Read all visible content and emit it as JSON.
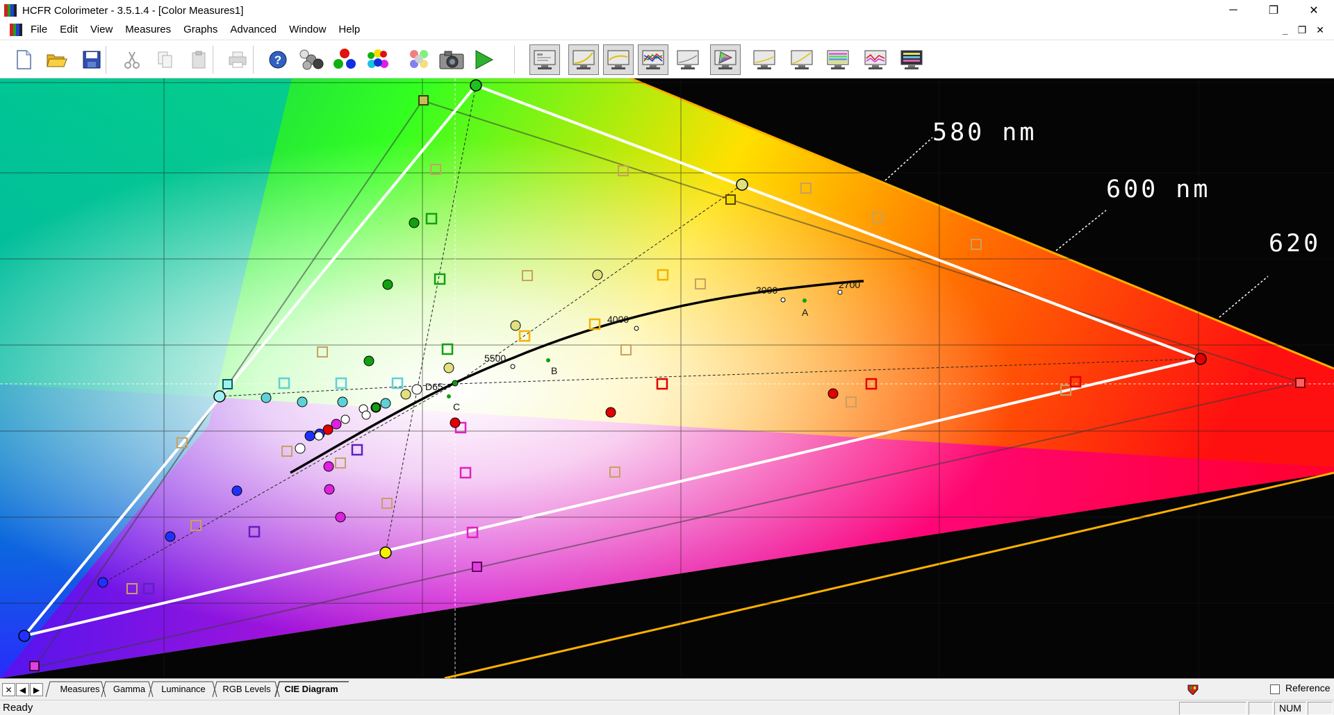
{
  "window": {
    "title": "HCFR Colorimeter - 3.5.1.4 - [Color Measures1]",
    "controls": {
      "minimize": "─",
      "restore": "❐",
      "close": "✕"
    }
  },
  "menu": {
    "items": [
      "File",
      "Edit",
      "View",
      "Measures",
      "Graphs",
      "Advanced",
      "Window",
      "Help"
    ],
    "mdi_controls": {
      "minimize": "_",
      "restore": "❐",
      "close": "✕"
    }
  },
  "toolbar": {
    "buttons": [
      {
        "name": "new-document-button",
        "icon": "new-document-icon"
      },
      {
        "name": "open-folder-button",
        "icon": "open-folder-icon"
      },
      {
        "name": "save-button",
        "icon": "floppy-disk-icon"
      },
      {
        "name": "cut-button",
        "icon": "scissors-icon",
        "disabled": true
      },
      {
        "name": "copy-button",
        "icon": "copy-icon",
        "disabled": true
      },
      {
        "name": "paste-button",
        "icon": "paste-icon",
        "disabled": true
      },
      {
        "name": "print-button",
        "icon": "printer-icon",
        "disabled": true
      },
      {
        "name": "help-button",
        "icon": "help-icon"
      },
      {
        "name": "measure-gray-button",
        "icon": "gray-spheres-icon"
      },
      {
        "name": "measure-primaries-button",
        "icon": "rgb-spheres-icon"
      },
      {
        "name": "measure-secondaries-button",
        "icon": "secondary-spheres-icon"
      },
      {
        "name": "measure-saturations-button",
        "icon": "saturation-spheres-icon"
      },
      {
        "name": "camera-button",
        "icon": "camera-icon"
      },
      {
        "name": "run-button",
        "icon": "play-icon"
      },
      {
        "name": "view-measures-button",
        "icon": "monitor-measures-icon",
        "pressed": true
      },
      {
        "name": "view-gamma-button",
        "icon": "monitor-gamma-icon",
        "pressed": true
      },
      {
        "name": "view-luminance-button",
        "icon": "monitor-luminance-icon",
        "pressed": true
      },
      {
        "name": "view-rgb-levels-button",
        "icon": "monitor-rgb-levels-icon",
        "pressed": true
      },
      {
        "name": "view-color-temp-button",
        "icon": "monitor-color-temp-icon"
      },
      {
        "name": "view-cie-diagram-button",
        "icon": "monitor-cie-icon",
        "pressed": true
      },
      {
        "name": "view-delta-e-button",
        "icon": "monitor-delta-e-icon"
      },
      {
        "name": "view-near-black-button",
        "icon": "monitor-near-black-icon"
      },
      {
        "name": "view-saturation-shift-button",
        "icon": "monitor-saturation-shift-icon"
      },
      {
        "name": "view-color-comparator-button",
        "icon": "monitor-comparator-icon"
      },
      {
        "name": "view-free-measures-button",
        "icon": "monitor-free-measures-icon"
      }
    ]
  },
  "diagram": {
    "wavelength_labels": [
      "580  nm",
      "600  nm",
      "620"
    ],
    "planckian_labels": [
      "5500",
      "4000",
      "3000",
      "2700"
    ],
    "white_point_labels": [
      "D65",
      "A",
      "B",
      "C"
    ],
    "colors": {
      "red": "#e60000",
      "green": "#00b300",
      "blue": "#1a1aff",
      "cyan": "#5fd0d8",
      "magenta": "#e000e0",
      "yellow": "#f5f000",
      "reference_marker": "#c8a060",
      "gamut_outline": "#ffffff"
    }
  },
  "tabs": {
    "nav_buttons": [
      "✕",
      "◀",
      "▶"
    ],
    "items": [
      "Measures",
      "Gamma",
      "Luminance",
      "RGB Levels",
      "CIE Diagram"
    ],
    "active": "CIE Diagram",
    "reference_label": "Reference"
  },
  "status": {
    "text": "Ready",
    "indicators": [
      "",
      "",
      "NUM",
      ""
    ]
  }
}
